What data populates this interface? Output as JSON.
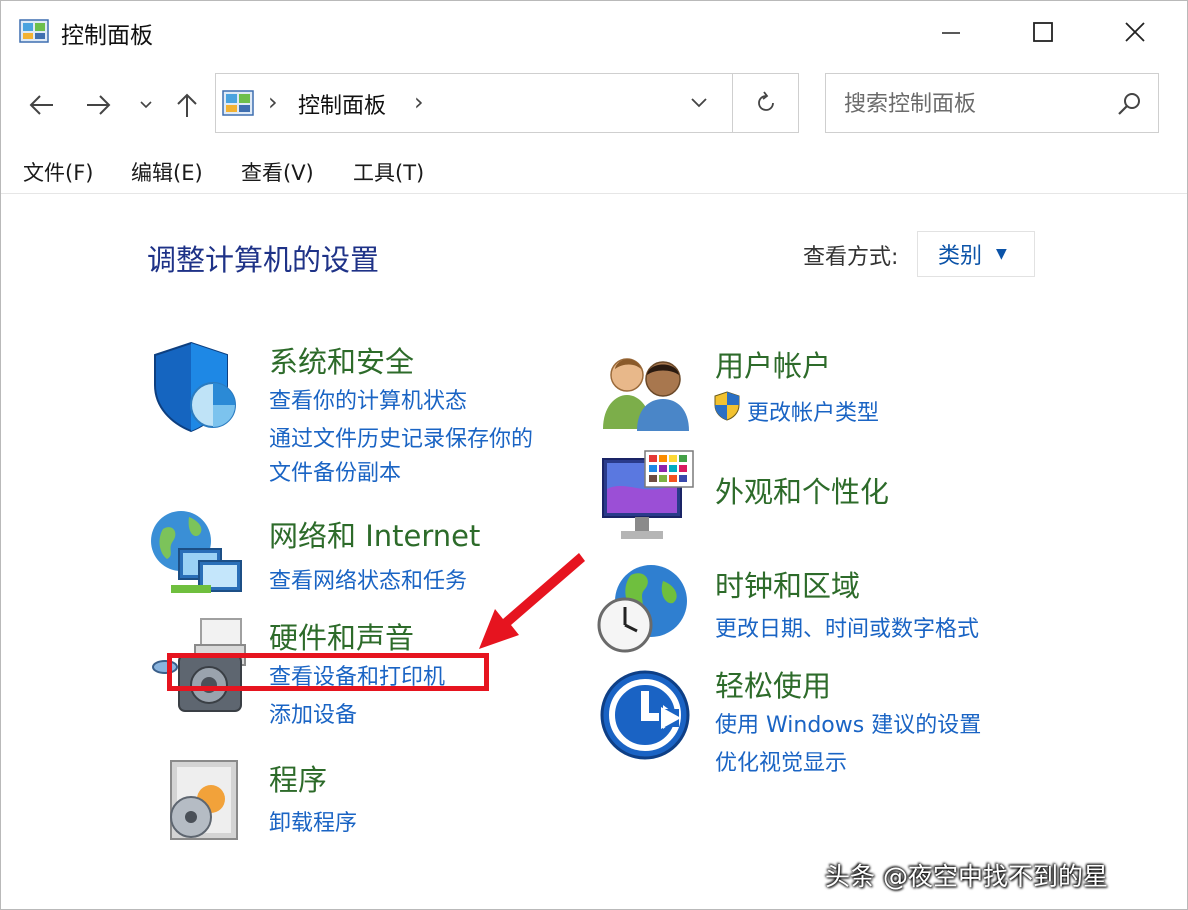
{
  "window": {
    "title": "控制面板"
  },
  "address": {
    "crumb": "控制面板"
  },
  "search": {
    "placeholder": "搜索控制面板"
  },
  "menu": [
    "文件(F)",
    "编辑(E)",
    "查看(V)",
    "工具(T)"
  ],
  "content": {
    "heading": "调整计算机的设置",
    "view_by_label": "查看方式:",
    "view_by_value": "类别"
  },
  "categories": {
    "system_security": {
      "title": "系统和安全",
      "links": [
        "查看你的计算机状态",
        "通过文件历史记录保存你的",
        "文件备份副本"
      ]
    },
    "network": {
      "title": "网络和 Internet",
      "links": [
        "查看网络状态和任务"
      ]
    },
    "hardware": {
      "title": "硬件和声音",
      "links": [
        "查看设备和打印机",
        "添加设备"
      ]
    },
    "programs": {
      "title": "程序",
      "links": [
        "卸载程序"
      ]
    },
    "user_accounts": {
      "title": "用户帐户",
      "links": [
        "更改帐户类型"
      ]
    },
    "appearance": {
      "title": "外观和个性化"
    },
    "clock_region": {
      "title": "时钟和区域",
      "links": [
        "更改日期、时间或数字格式"
      ]
    },
    "ease_of_access": {
      "title": "轻松使用",
      "links": [
        "使用 Windows 建议的设置",
        "优化视觉显示"
      ]
    }
  },
  "watermark": "头条 @夜空中找不到的星",
  "colors": {
    "accent": "#1a64c4",
    "category_title": "#2d6b2a",
    "heading": "#1e3287",
    "highlight": "#e6141f"
  }
}
